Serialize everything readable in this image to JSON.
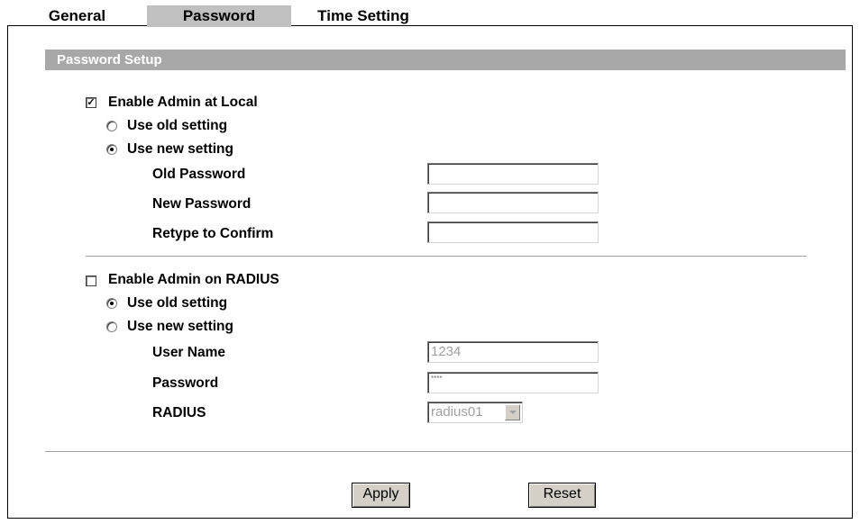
{
  "tabs": [
    {
      "label": "General",
      "active": false
    },
    {
      "label": "Password",
      "active": true
    },
    {
      "label": "Time Setting",
      "active": false
    }
  ],
  "section": {
    "title": "Password Setup"
  },
  "local": {
    "enable_label": "Enable Admin at Local",
    "enable_checked": true,
    "use_old_label": "Use old setting",
    "use_new_label": "Use new setting",
    "selected": "new",
    "old_password_label": "Old Password",
    "old_password_value": "",
    "new_password_label": "New Password",
    "new_password_value": "",
    "retype_label": "Retype to Confirm",
    "retype_value": ""
  },
  "radius": {
    "enable_label": "Enable Admin on RADIUS",
    "enable_checked": false,
    "use_old_label": "Use old setting",
    "use_new_label": "Use new setting",
    "selected": "old",
    "user_name_label": "User Name",
    "user_name_value": "1234",
    "password_label": "Password",
    "password_value": "****",
    "radius_label": "RADIUS",
    "radius_value": "radius01"
  },
  "buttons": {
    "apply": "Apply",
    "reset": "Reset"
  },
  "icons": {
    "dropdown": "chevron-down-icon",
    "check": "checkmark-icon"
  }
}
